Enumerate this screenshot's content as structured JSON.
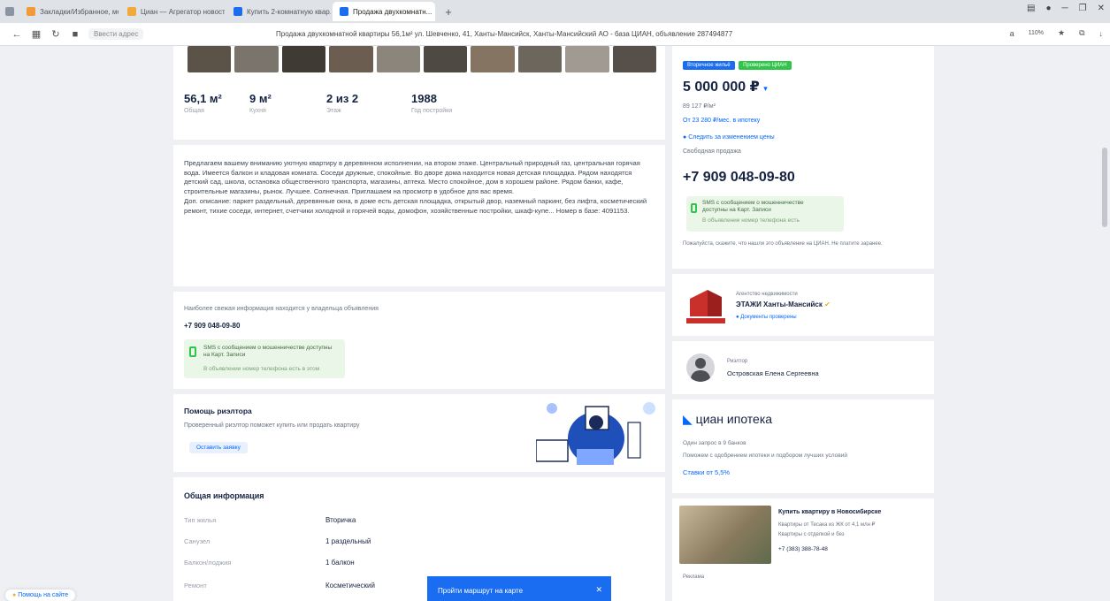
{
  "browser": {
    "tabs": [
      {
        "label": "Закладки/Избранное, меню",
        "color": "#f29a36"
      },
      {
        "label": "Циан — Агрегатор новостей",
        "color": "#f1a93a"
      },
      {
        "label": "Купить 2-комнатную квар...",
        "color": "#1a6cf0"
      },
      {
        "label": "Продажа двухкомнатн...",
        "color": "#1a6cf0"
      }
    ],
    "address_chip": "Ввести адрес",
    "page_title": "Продажа двухкомнатной квартиры 56,1м² ул. Шевченко, 41, Ханты-Мансийск, Ханты-Мансийский АО - база ЦИАН, объявление 287494877",
    "zoom": "110%",
    "zoom_label": "Читать"
  },
  "listing": {
    "stats": [
      {
        "value": "56,1 м²",
        "label": "Общая"
      },
      {
        "value": "9 м²",
        "label": "Кухня"
      },
      {
        "value": "2 из 2",
        "label": "Этаж"
      },
      {
        "value": "1988",
        "label": "Год постройки"
      }
    ],
    "description": "Предлагаем вашему вниманию уютную квартиру в деревянном исполнении, на втором этаже. Центральный природный газ, центральная горячая вода. Имеется балкон и кладовая комната. Соседи дружные, спокойные. Во дворе дома находится новая детская площадка. Рядом находятся детский сад, школа, остановка общественного транспорта, магазины, аптека. Место спокойное, дом в хорошем районе. Рядом банки, кафе, строительные магазины, рынок. Лучшее. Солнечная. Приглашаем на просмотр в удобное для вас время.\nДоп. описание: паркет раздельный, деревянные окна, в доме есть детская площадка, открытый двор, наземный паркинг, без лифта, косметический ремонт, тихие соседи, интернет, счетчики холодной и горячей воды, домофон, хозяйственные постройки, шкаф-купе... Номер в базе: 4091153.",
    "contact_note": "Наиболее свежая информация находится у владельца объявления",
    "phone_short": "+7 909 048-09-80",
    "sms_note": "SMS с сообщением о мошенничестве доступны на Карт. Записи",
    "sms_note2": "В объявлении номер телефона есть в этом",
    "help_title": "Помощь риэлтора",
    "help_text": "Проверенный риэлтор поможет купить или продать квартиру",
    "help_button": "Оставить заявку",
    "info_title": "Общая информация",
    "info_rows": [
      {
        "k": "Тип жилья",
        "v": "Вторичка"
      },
      {
        "k": "Санузел",
        "v": "1 раздельный"
      },
      {
        "k": "Балкон/лоджия",
        "v": "1 балкон"
      },
      {
        "k": "Ремонт",
        "v": "Косметический"
      }
    ],
    "banner_text": "Пройти маршрут на карте",
    "help_float": "Помощь на сайте"
  },
  "sidebar": {
    "badge1": "Вторичное жильё",
    "badge2": "Проверено ЦИАН",
    "price": "5 000 000 ₽",
    "price_per_m": "89 127 ₽/м²",
    "mortgage": "От 23 280 ₽/мес. в ипотеку",
    "watch": "Следить за изменением цены",
    "status": "Свободная продажа",
    "phone": "+7 909 048-09-80",
    "sms1": "SMS с сообщением о мошенничестве",
    "sms2": "доступны на Карт. Записи",
    "sms3": "В объявлении номер телефона есть",
    "disclaimer": "Пожалуйста, скажите, что нашли это объявление на ЦИАН. Не платите заранее.",
    "agency_sub": "Агентство недвижимости",
    "agency": "ЭТАЖИ Ханты-Мансийск",
    "agency_docs": "Документы проверены",
    "agent_role": "Риэлтор",
    "agent": "Островская Елена Сергеевна",
    "mortgage_logo": "циан ипотека",
    "mortgage_l1": "Один запрос в 9 банков",
    "mortgage_l2": "Поможем с одобрением ипотеки и подбором лучших условий",
    "mortgage_rate": "Ставки от 5,5%",
    "ad_title": "Купить квартиру в Новосибирске",
    "ad_l1": "Квартиры от Тесака из ЖК от 4,1 млн ₽",
    "ad_l2": "Квартиры с отделкой и без",
    "ad_phone": "+7 (383) 388-78-48",
    "ad_label": "Реклама"
  },
  "colors": {
    "accent": "#0468ff",
    "badge_blue": "#1a6cf0",
    "badge_green": "#31c44a",
    "sms_bg": "#eaf6e8"
  }
}
